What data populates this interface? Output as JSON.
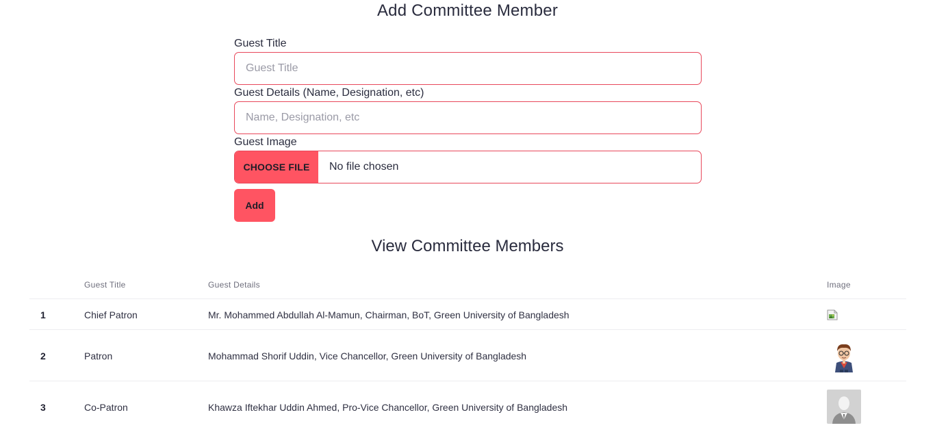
{
  "form": {
    "title": "Add Committee Member",
    "guest_title_label": "Guest Title",
    "guest_title_placeholder": "Guest Title",
    "guest_details_label": "Guest Details (Name, Designation, etc)",
    "guest_details_placeholder": "Name, Designation, etc",
    "guest_image_label": "Guest Image",
    "choose_file_label": "Choose File",
    "file_status": "No file chosen",
    "add_label": "Add"
  },
  "table": {
    "title": "View Committee Members",
    "headers": {
      "title": "Guest Title",
      "details": "Guest Details",
      "image": "Image"
    },
    "rows": [
      {
        "num": "1",
        "title": "Chief Patron",
        "details": "Mr. Mohammed Abdullah Al-Mamun, Chairman, BoT, Green University of Bangladesh",
        "image": "broken-image-icon"
      },
      {
        "num": "2",
        "title": "Patron",
        "details": "Mohammad Shorif Uddin, Vice Chancellor, Green University of Bangladesh",
        "image": "cartoon-avatar"
      },
      {
        "num": "3",
        "title": "Co-Patron",
        "details": "Khawza Iftekhar Uddin Ahmed, Pro-Vice Chancellor, Green University of Bangladesh",
        "image": "default-person-avatar"
      }
    ]
  },
  "colors": {
    "accent": "#ff5462",
    "border": "#e8475a"
  }
}
